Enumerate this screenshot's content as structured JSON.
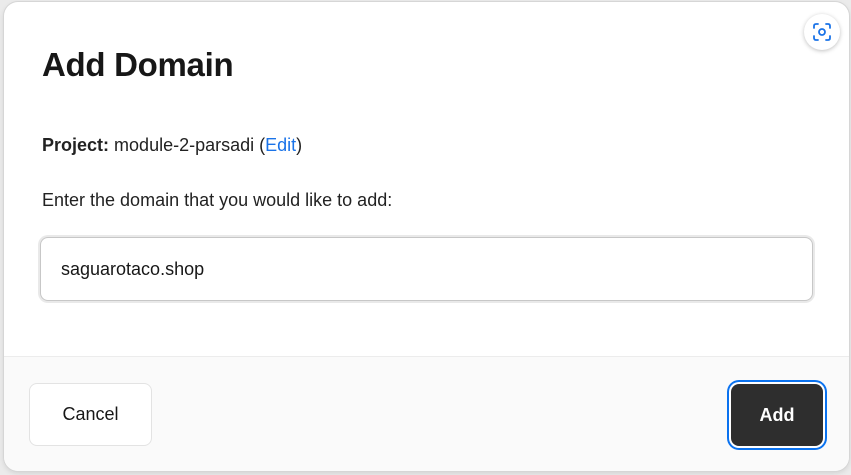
{
  "dialog": {
    "title": "Add Domain",
    "project_label": "Project:",
    "project_name": "module-2-parsadi",
    "edit_link": "Edit",
    "prompt": "Enter the domain that you would like to add:",
    "domain_value": "saguarotaco.shop"
  },
  "footer": {
    "cancel_label": "Cancel",
    "add_label": "Add"
  },
  "icons": {
    "scan": "scan-focus-icon"
  },
  "colors": {
    "accent": "#1a73e8",
    "focus_ring": "#0a72ef",
    "primary_button": "#2e2e2e"
  }
}
